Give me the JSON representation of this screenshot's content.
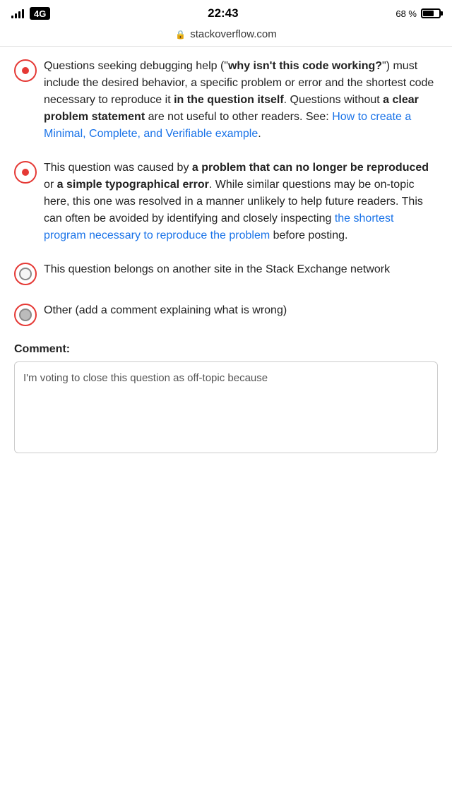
{
  "statusBar": {
    "time": "22:43",
    "batteryPct": "68 %",
    "url": "stackoverflow.com"
  },
  "options": [
    {
      "id": "option-1",
      "selected": true,
      "radioStyle": "dot",
      "text_parts": [
        {
          "type": "text",
          "content": "Questions seeking debugging help (\""
        },
        {
          "type": "bold",
          "content": "why isn't this code working?"
        },
        {
          "type": "text",
          "content": "\") must include the desired behavior, a specific problem or error and the shortest code necessary to reproduce it "
        },
        {
          "type": "bold",
          "content": "in the question itself"
        },
        {
          "type": "text",
          "content": ". Questions without "
        },
        {
          "type": "bold",
          "content": "a clear problem statement"
        },
        {
          "type": "text",
          "content": " are not useful to other readers. See: "
        },
        {
          "type": "link",
          "content": "How to create a Minimal, Complete, and Verifiable example"
        },
        {
          "type": "text",
          "content": "."
        }
      ]
    },
    {
      "id": "option-2",
      "selected": true,
      "radioStyle": "dot",
      "text_parts": [
        {
          "type": "text",
          "content": "This question was caused by "
        },
        {
          "type": "bold",
          "content": "a problem that can no longer be reproduced"
        },
        {
          "type": "text",
          "content": " or "
        },
        {
          "type": "bold",
          "content": "a simple typographical error"
        },
        {
          "type": "text",
          "content": ". While similar questions may be on-topic here, this one was resolved in a manner unlikely to help future readers. This can often be avoided by identifying and closely inspecting "
        },
        {
          "type": "link",
          "content": "the shortest program necessary to reproduce the problem"
        },
        {
          "type": "text",
          "content": " before posting."
        }
      ]
    },
    {
      "id": "option-3",
      "selected": false,
      "radioStyle": "ring",
      "text_plain": "This question belongs on another site in the Stack Exchange network"
    },
    {
      "id": "option-4",
      "selected": false,
      "radioStyle": "ring",
      "text_plain": "Other (add a comment explaining what is wrong)"
    }
  ],
  "comment": {
    "label": "Comment:",
    "placeholder": "I'm voting to close this question as off-topic because",
    "value": "I'm voting to close this question as off-topic because"
  }
}
